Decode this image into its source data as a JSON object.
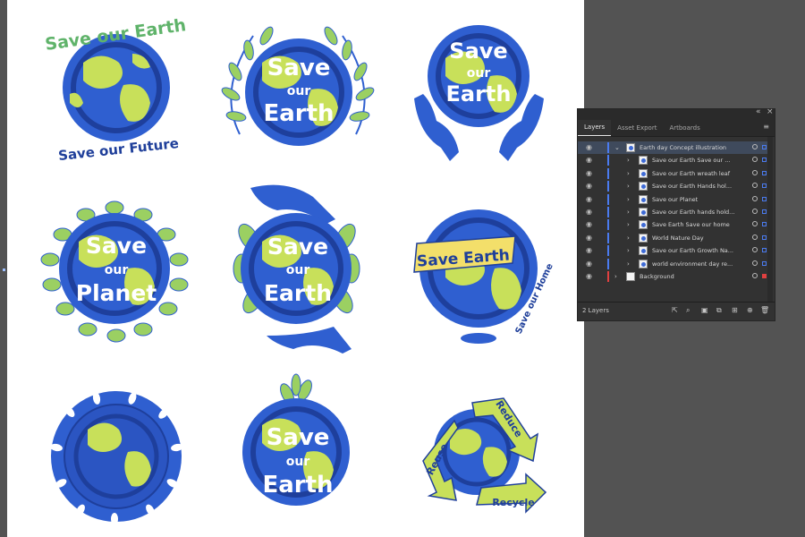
{
  "artboard": {
    "badges": [
      {
        "id": "b1",
        "top_text": "Save our Earth",
        "bottom_text": "Save our Future"
      },
      {
        "id": "b2",
        "lines": [
          "Save",
          "our",
          "Earth"
        ]
      },
      {
        "id": "b3",
        "lines": [
          "Save",
          "our",
          "Earth"
        ]
      },
      {
        "id": "b4",
        "lines": [
          "Save",
          "our",
          "Planet"
        ]
      },
      {
        "id": "b5",
        "lines": [
          "Save",
          "our",
          "Earth"
        ]
      },
      {
        "id": "b6",
        "ribbon": "Save Earth",
        "side_text": "Save our Home"
      },
      {
        "id": "b7"
      },
      {
        "id": "b8",
        "lines": [
          "Save",
          "our",
          "Earth"
        ]
      },
      {
        "id": "b9",
        "arrows": [
          "Reduce",
          "Reuse",
          "Recycle"
        ]
      }
    ],
    "colors": {
      "ocean": "#2f5fd0",
      "ocean_dark": "#1e3f9c",
      "land": "#c8e05a",
      "leaf": "#9bd062",
      "text_dark": "#1f3f9a",
      "text_green": "#5fb36a"
    }
  },
  "panel": {
    "collapse_icon": "collapse-icon",
    "close_icon": "close-icon",
    "tabs": [
      "Layers",
      "Asset Export",
      "Artboards"
    ],
    "layers": [
      {
        "name": "Earth day Concept illustration",
        "expanded": true,
        "stripe": "#4a7bf0",
        "sel": "#4a7bf0"
      },
      {
        "name": "Save our Earth Save our ...",
        "stripe": "#4a7bf0",
        "sel": "#4a7bf0"
      },
      {
        "name": "Save our Earth wreath leaf",
        "stripe": "#4a7bf0",
        "sel": "#4a7bf0"
      },
      {
        "name": "Save our Earth Hands hol...",
        "stripe": "#4a7bf0",
        "sel": "#4a7bf0"
      },
      {
        "name": "Save our Planet",
        "stripe": "#4a7bf0",
        "sel": "#4a7bf0"
      },
      {
        "name": "Save our Earth hands hold...",
        "stripe": "#4a7bf0",
        "sel": "#4a7bf0"
      },
      {
        "name": "Save Earth Save our home",
        "stripe": "#4a7bf0",
        "sel": "#4a7bf0"
      },
      {
        "name": "World Nature Day",
        "stripe": "#4a7bf0",
        "sel": "#4a7bf0"
      },
      {
        "name": "Save our Earth Growth Na...",
        "stripe": "#4a7bf0",
        "sel": "#4a7bf0"
      },
      {
        "name": "world environment day re...",
        "stripe": "#4a7bf0",
        "sel": "#4a7bf0"
      },
      {
        "name": "Background",
        "stripe": "#e04040",
        "sel": "#e04040"
      }
    ],
    "footer": {
      "count": "2 Layers"
    }
  }
}
